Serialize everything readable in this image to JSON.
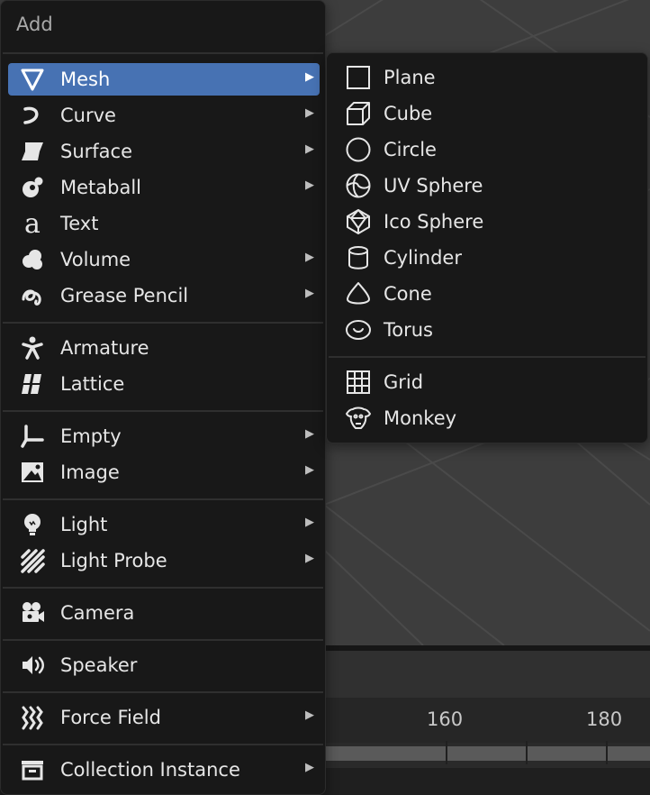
{
  "timeline": {
    "frames": [
      "160",
      "180"
    ]
  },
  "add_menu": {
    "title": "Add",
    "items": [
      {
        "label": "Mesh",
        "icon": "mesh-icon",
        "submenu": true,
        "active": true
      },
      {
        "label": "Curve",
        "icon": "curve-icon",
        "submenu": true
      },
      {
        "label": "Surface",
        "icon": "surface-icon",
        "submenu": true
      },
      {
        "label": "Metaball",
        "icon": "metaball-icon",
        "submenu": true
      },
      {
        "label": "Text",
        "icon": "text-icon",
        "submenu": false
      },
      {
        "label": "Volume",
        "icon": "volume-icon",
        "submenu": true
      },
      {
        "label": "Grease Pencil",
        "icon": "grease-pencil-icon",
        "submenu": true
      },
      {
        "label": "Armature",
        "icon": "armature-icon",
        "submenu": false
      },
      {
        "label": "Lattice",
        "icon": "lattice-icon",
        "submenu": false
      },
      {
        "label": "Empty",
        "icon": "empty-icon",
        "submenu": true
      },
      {
        "label": "Image",
        "icon": "image-icon",
        "submenu": true
      },
      {
        "label": "Light",
        "icon": "light-icon",
        "submenu": true
      },
      {
        "label": "Light Probe",
        "icon": "light-probe-icon",
        "submenu": true
      },
      {
        "label": "Camera",
        "icon": "camera-icon",
        "submenu": false
      },
      {
        "label": "Speaker",
        "icon": "speaker-icon",
        "submenu": false
      },
      {
        "label": "Force Field",
        "icon": "force-field-icon",
        "submenu": true
      },
      {
        "label": "Collection Instance",
        "icon": "collection-instance-icon",
        "submenu": true
      }
    ]
  },
  "mesh_menu": {
    "items": [
      {
        "label": "Plane",
        "icon": "plane-icon"
      },
      {
        "label": "Cube",
        "icon": "cube-icon"
      },
      {
        "label": "Circle",
        "icon": "circle-icon"
      },
      {
        "label": "UV Sphere",
        "icon": "uv-sphere-icon"
      },
      {
        "label": "Ico Sphere",
        "icon": "ico-sphere-icon"
      },
      {
        "label": "Cylinder",
        "icon": "cylinder-icon"
      },
      {
        "label": "Cone",
        "icon": "cone-icon"
      },
      {
        "label": "Torus",
        "icon": "torus-icon"
      },
      {
        "label": "Grid",
        "icon": "grid-icon"
      },
      {
        "label": "Monkey",
        "icon": "monkey-icon"
      }
    ]
  },
  "colors": {
    "highlight": "#4772b3",
    "menu_bg": "#181818",
    "text": "#e6e6e6"
  }
}
